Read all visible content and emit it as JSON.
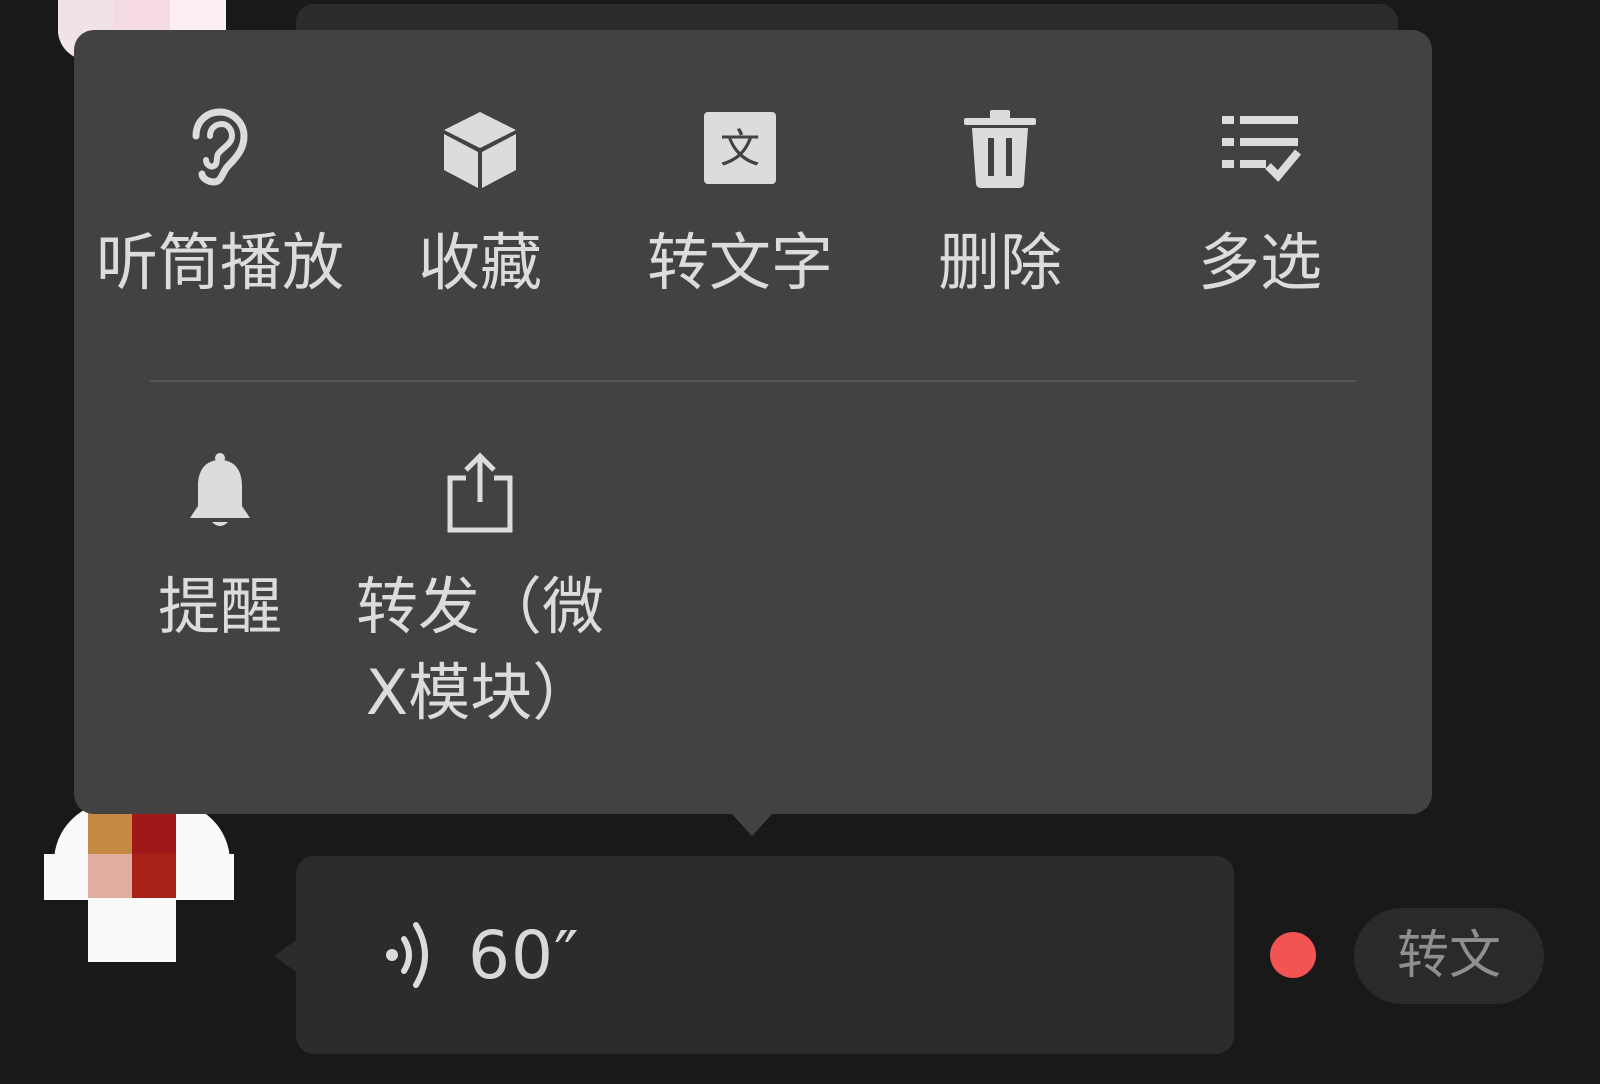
{
  "popup_menu": {
    "row1": [
      {
        "label": "听筒播放",
        "icon": "ear-icon"
      },
      {
        "label": "收藏",
        "icon": "cube-icon"
      },
      {
        "label": "转文字",
        "icon": "text-convert-icon",
        "icon_glyph": "文"
      },
      {
        "label": "删除",
        "icon": "trash-icon"
      },
      {
        "label": "多选",
        "icon": "multi-select-icon"
      }
    ],
    "row2": [
      {
        "label": "提醒",
        "icon": "bell-icon"
      },
      {
        "label": "转发（微\nX模块）",
        "icon": "share-icon"
      }
    ]
  },
  "voice_message": {
    "duration": "60″",
    "icon": "voice-wave-icon",
    "unread": true
  },
  "convert_pill": {
    "label": "转文"
  },
  "colors": {
    "background": "#191919",
    "popup": "#424242",
    "bubble": "#2c2c2c",
    "text": "#dcdcdc",
    "unread_dot": "#f25454"
  }
}
